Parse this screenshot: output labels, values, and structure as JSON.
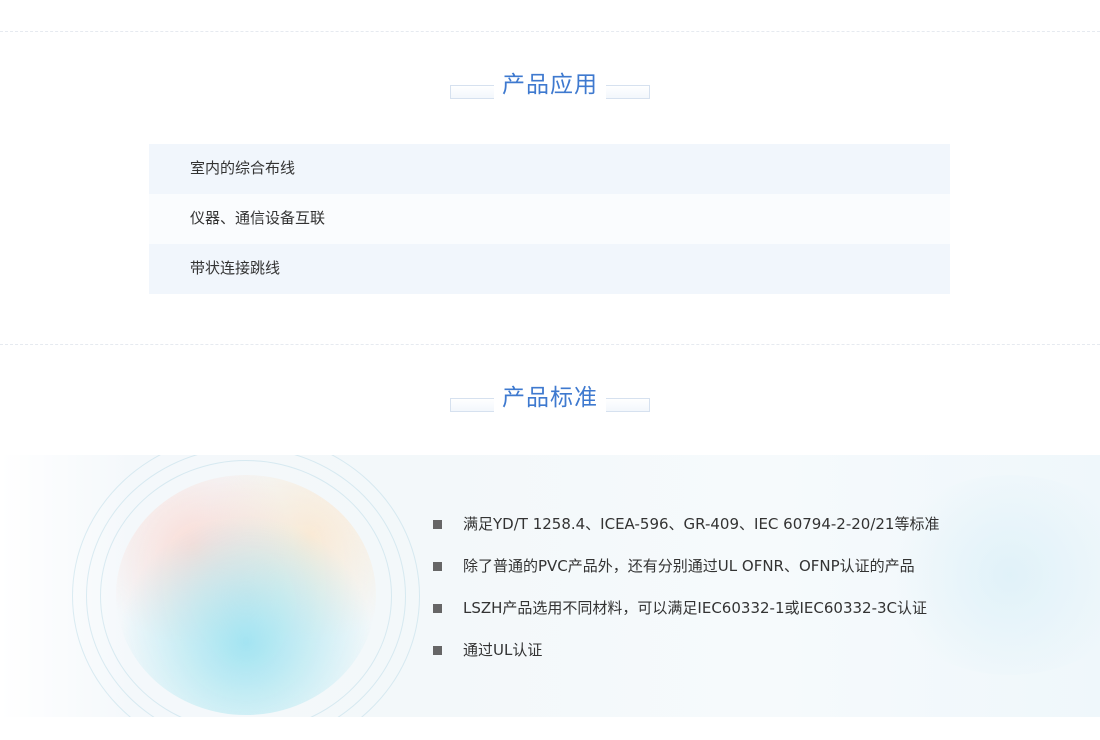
{
  "sections": {
    "applications": {
      "title": "产品应用",
      "items": [
        "室内的综合布线",
        "仪器、通信设备互联",
        "带状连接跳线"
      ]
    },
    "standards": {
      "title": "产品标准",
      "items": [
        "满足YD/T 1258.4、ICEA-596、GR-409、IEC 60794-2-20/21等标准",
        "除了普通的PVC产品外，还有分别通过UL OFNR、OFNP认证的产品",
        "LSZH产品选用不同材料，可以满足IEC60332-1或IEC60332-3C认证",
        "通过UL认证"
      ]
    }
  },
  "icons": {
    "bullet": "square-bullet-icon",
    "decoration": "globe-illustration"
  },
  "colors": {
    "title": "#3e79cf",
    "row_odd": "#f1f6fc",
    "row_even": "#fafcfe",
    "bullet": "#666666"
  }
}
